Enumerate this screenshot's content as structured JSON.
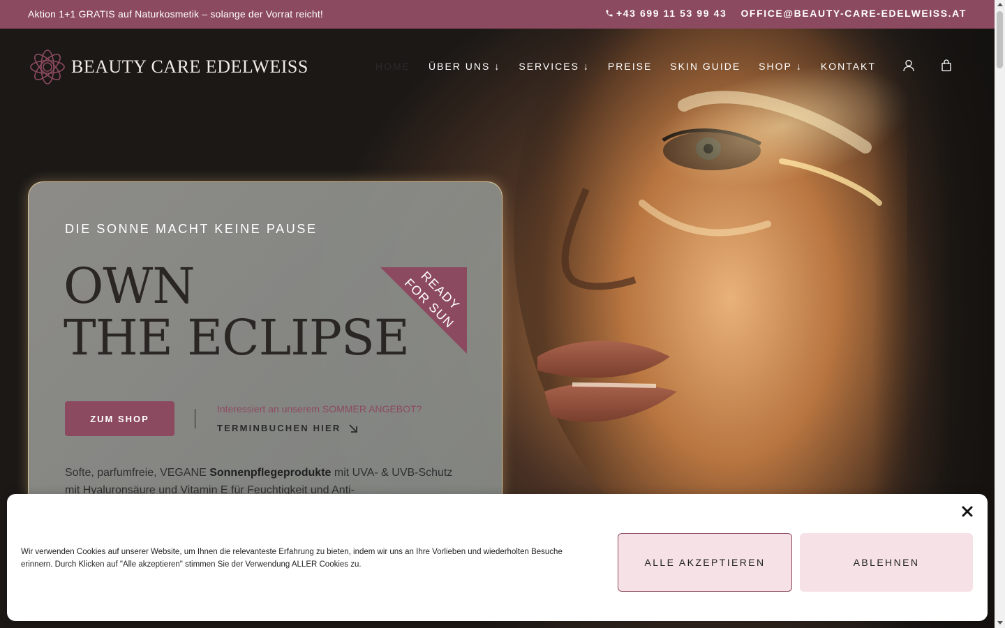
{
  "topbar": {
    "promo": "Aktion 1+1 GRATIS auf Naturkosmetik – solange der Vorrat reicht!",
    "phone": "+43 699 11 53 99 43",
    "email": "OFFICE@BEAUTY-CARE-EDELWEISS.AT",
    "phone_icon": "phone-icon",
    "background_color": "#8c4a60"
  },
  "header": {
    "logo_text": "BEAUTY CARE EDELWEISS",
    "nav": [
      {
        "label": "HOME",
        "active": true
      },
      {
        "label": "ÜBER UNS",
        "arrow": "↓"
      },
      {
        "label": "SERVICES",
        "arrow": "↓"
      },
      {
        "label": "PREISE"
      },
      {
        "label": "SKIN GUIDE"
      },
      {
        "label": "SHOP",
        "arrow": "↓"
      },
      {
        "label": "KONTAKT"
      }
    ],
    "icons": [
      "user-icon",
      "shopping-bag-icon"
    ]
  },
  "hero": {
    "eyebrow": "DIE SONNE MACHT KEINE PAUSE",
    "headline_line1": "OWN",
    "headline_line2": "THE ECLIPSE",
    "ribbon_line1": "READY",
    "ribbon_line2": "FOR SUN",
    "shop_button": "ZUM SHOP",
    "offer_text": "Interessiert an unserem SOMMER ANGEBOT?",
    "termin_link": "TERMINBUCHEN HIER",
    "body_part1": "Softe, parfumfreie, VEGANE ",
    "body_bold": "Sonnenpflegeprodukte",
    "body_part2": " mit UVA- & UVB-Schutz mit Hyaluronsäure und Vitamin E für Feuchtigkeit und Anti-",
    "accent_color": "#8c4a60"
  },
  "cookie": {
    "text": "Wir verwenden Cookies auf unserer Website, um Ihnen die relevanteste Erfahrung zu bieten, indem wir uns an Ihre Vorlieben und wiederholten Besuche erinnern. Durch Klicken auf \"Alle akzeptieren\" stimmen Sie der Verwendung ALLER Cookies zu.",
    "accept_label": "ALLE AKZEPTIEREN",
    "decline_label": "ABLEHNEN",
    "close_icon": "close-icon"
  }
}
